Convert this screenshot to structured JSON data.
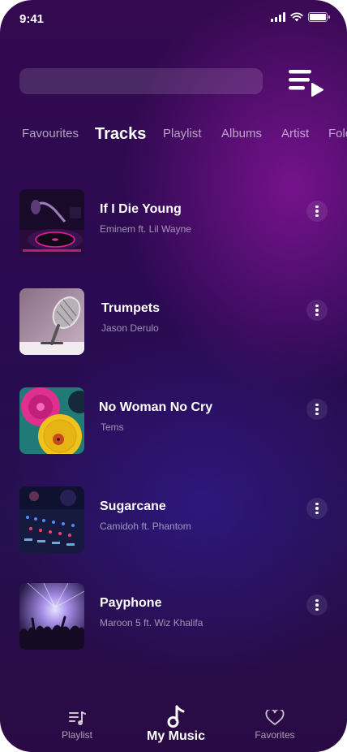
{
  "status_bar": {
    "time": "9:41",
    "icons": [
      "signal-icon",
      "wifi-icon",
      "battery-icon"
    ]
  },
  "header": {
    "search_placeholder": "",
    "queue_icon": "playlist-play-icon"
  },
  "tabs": [
    {
      "label": "Favourites",
      "active": false
    },
    {
      "label": "Tracks",
      "active": true
    },
    {
      "label": "Playlist",
      "active": false
    },
    {
      "label": "Albums",
      "active": false
    },
    {
      "label": "Artist",
      "active": false
    },
    {
      "label": "Folders",
      "active": false
    }
  ],
  "tracks": [
    {
      "title": "If I Die Young",
      "artist": "Eminem ft. Lil Wayne",
      "cover": "dj-turntable"
    },
    {
      "title": "Trumpets",
      "artist": "Jason Derulo",
      "cover": "microphone"
    },
    {
      "title": "No Woman No Cry",
      "artist": "Tems",
      "cover": "vinyl-records"
    },
    {
      "title": "Sugarcane",
      "artist": "Camidoh ft. Phantom",
      "cover": "mixer-console"
    },
    {
      "title": "Payphone",
      "artist": "Maroon 5 ft. Wiz Khalifa",
      "cover": "concert-crowd"
    }
  ],
  "bottom_nav": [
    {
      "label": "Playlist",
      "icon": "playlist-icon",
      "active": false
    },
    {
      "label": "My Music",
      "icon": "music-note-icon",
      "active": true
    },
    {
      "label": "Favorites",
      "icon": "heart-icon",
      "active": false
    }
  ],
  "colors": {
    "background_top": "#34094f",
    "background_bottom": "#2a0a45",
    "accent_glow": "#8214a0",
    "text_primary": "#ffffff"
  }
}
